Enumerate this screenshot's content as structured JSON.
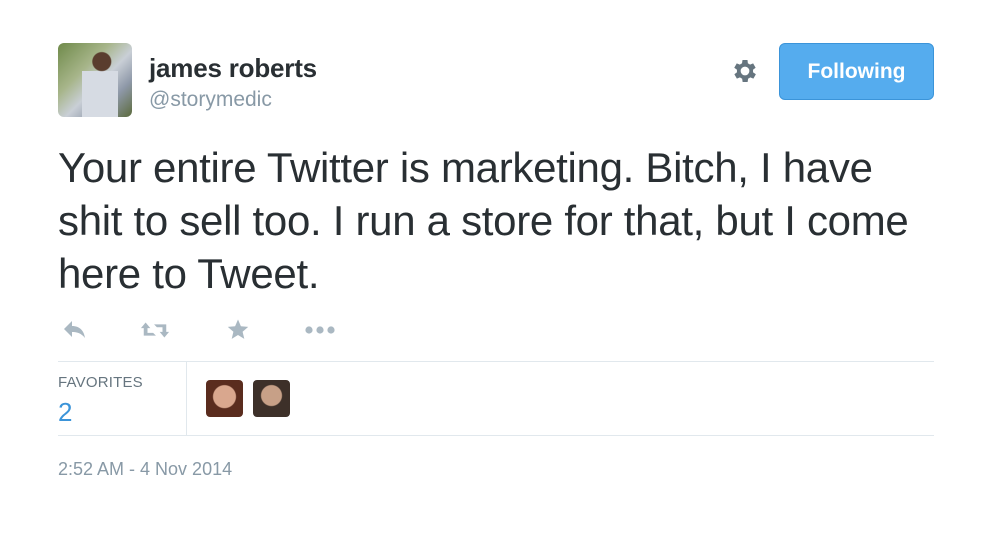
{
  "user": {
    "name": "james roberts",
    "handle": "@storymedic"
  },
  "header": {
    "follow_label": "Following",
    "gear_icon": "gear-icon"
  },
  "tweet": {
    "text": "Your entire Twitter is marketing. Bitch, I have shit to sell too. I run a store for that, but I come here to Tweet."
  },
  "actions": [
    {
      "icon": "reply-icon"
    },
    {
      "icon": "retweet-icon"
    },
    {
      "icon": "favorite-star-icon"
    },
    {
      "icon": "more-dots-icon"
    }
  ],
  "stats": {
    "favorites_label": "FAVORITES",
    "favorites_count": "2"
  },
  "timestamp": "2:52 AM - 4 Nov 2014",
  "colors": {
    "accent": "#55acee",
    "link": "#3b94d9",
    "muted": "#8899a6",
    "text": "#292f33",
    "icon": "#aab8c2"
  }
}
